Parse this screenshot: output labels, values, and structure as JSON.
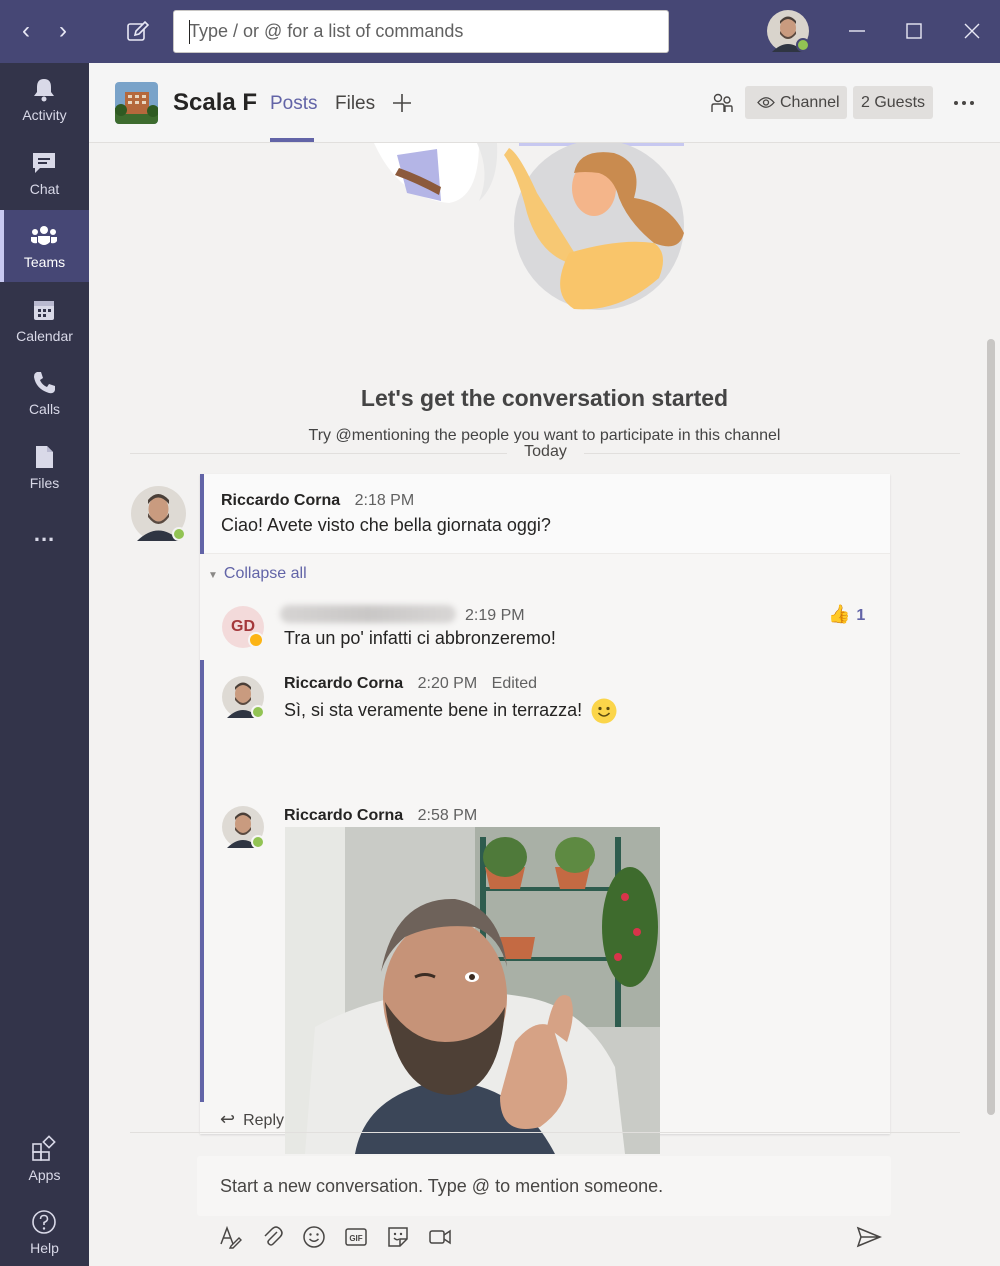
{
  "titlebar": {
    "search_placeholder": "Type / or @ for a list of commands",
    "colors": {
      "bar": "#464775",
      "rail": "#33344a",
      "accent": "#6264a7",
      "presence": "#92c353"
    }
  },
  "rail": {
    "items": [
      {
        "label": "Activity",
        "icon": "bell-icon"
      },
      {
        "label": "Chat",
        "icon": "chat-icon"
      },
      {
        "label": "Teams",
        "icon": "teams-icon"
      },
      {
        "label": "Calendar",
        "icon": "calendar-icon"
      },
      {
        "label": "Calls",
        "icon": "phone-icon"
      },
      {
        "label": "Files",
        "icon": "file-icon"
      }
    ],
    "more": "...",
    "apps_label": "Apps",
    "help_label": "Help"
  },
  "header": {
    "team_name": "Scala F",
    "tabs": [
      {
        "label": "Posts"
      },
      {
        "label": "Files"
      }
    ],
    "channel_label": "Channel",
    "guests_label": "2 Guests"
  },
  "empty_state": {
    "title": "Let's get the conversation started",
    "subtitle": "Try @mentioning the people you want to participate in this channel"
  },
  "divider": {
    "today": "Today"
  },
  "thread": {
    "post": {
      "author": "Riccardo Corna",
      "time": "2:18 PM",
      "text": "Ciao! Avete visto che bella giornata oggi?"
    },
    "collapse_label": "Collapse all",
    "replies": [
      {
        "initials": "GD",
        "time": "2:19 PM",
        "text": "Tra un po' infatti ci abbronzeremo!",
        "reaction_count": "1"
      },
      {
        "author": "Riccardo Corna",
        "time": "2:20 PM",
        "edited": "Edited",
        "text": "Sì, si sta veramente bene in terrazza!"
      },
      {
        "author": "Riccardo Corna",
        "time": "2:58 PM"
      }
    ],
    "reply_label": "Reply"
  },
  "composer": {
    "placeholder": "Start a new conversation. Type @ to mention someone."
  }
}
